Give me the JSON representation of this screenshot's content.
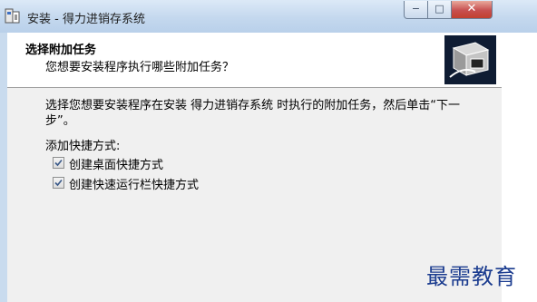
{
  "window": {
    "title": "安装 - 得力进销存系统",
    "controls": {
      "minimize": "−",
      "maximize": "□",
      "close": "✕"
    }
  },
  "header": {
    "title": "选择附加任务",
    "subtitle": "您想要安装程序执行哪些附加任务？"
  },
  "body": {
    "instruction": "选择您想要安装程序在安装 得力进销存系统 时执行的附加任务，然后单击“下一步”。",
    "group_label": "添加快捷方式:",
    "tasks": [
      {
        "label": "创建桌面快捷方式",
        "checked": true
      },
      {
        "label": "创建快速运行栏快捷方式",
        "checked": true
      }
    ]
  },
  "watermark": "最需教育",
  "icons": {
    "app": "installer-icon",
    "header": "installer-box-icon"
  }
}
